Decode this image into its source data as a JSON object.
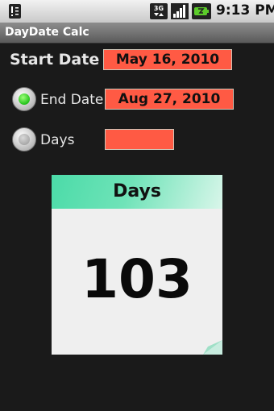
{
  "status_bar": {
    "time": "9:13 PM",
    "network": "3G",
    "icons": [
      "notification-icon",
      "network-3g-icon",
      "signal-icon",
      "battery-icon"
    ]
  },
  "app": {
    "title": "DayDate Calc"
  },
  "form": {
    "start_label": "Start Date",
    "start_value": "May 16, 2010",
    "end_label": "End Date",
    "end_value": "Aug 27, 2010",
    "days_label": "Days",
    "days_value": "",
    "selected_mode": "End Date"
  },
  "result": {
    "title": "Days",
    "value": "103"
  },
  "colors": {
    "field_bg": "#ff5a44",
    "card_header": "#4bdba8",
    "radio_selected": "#23c21a"
  }
}
